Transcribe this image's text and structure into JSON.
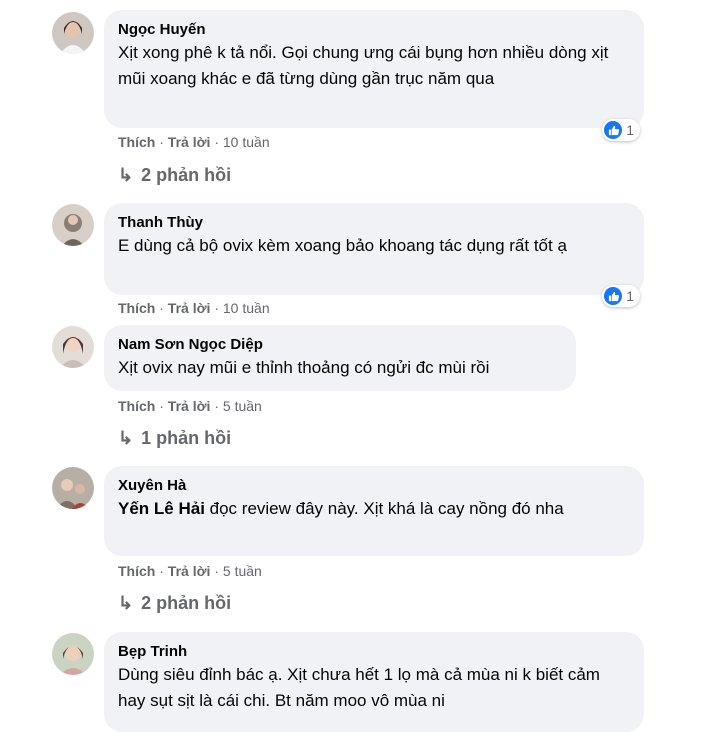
{
  "comments": [
    {
      "author": "Ngọc Huyến",
      "text": "Xịt xong phê k tả nổi. Gọi chung ưng cái bụng hơn nhiều dòng xịt mũi xoang khác e đã từng dùng gần trục năm qua",
      "like_label": "Thích",
      "reply_label": "Trả lời",
      "time": "10 tuần",
      "reactions": "1",
      "replies": "2 phản hồi"
    },
    {
      "author": "Thanh Thùy",
      "text": "E dùng cả bộ ovix kèm xoang bảo khoang tác dụng rất tốt ạ",
      "like_label": "Thích",
      "reply_label": "Trả lời",
      "time": "10 tuần",
      "reactions": "1"
    },
    {
      "author": "Nam Sơn Ngọc Diệp",
      "text": "Xịt ovix nay mũi e thỉnh thoảng có ngửi đc mùi rồi",
      "like_label": "Thích",
      "reply_label": "Trả lời",
      "time": "5 tuần",
      "replies": "1 phản hồi"
    },
    {
      "author": "Xuyên Hà",
      "mention": "Yến Lê Hải",
      "text": " đọc review đây này. Xịt khá là cay nồng đó nha",
      "like_label": "Thích",
      "reply_label": "Trả lời",
      "time": "5 tuần",
      "replies": "2 phản hồi"
    },
    {
      "author": "Bẹp Trinh",
      "text": "Dùng siêu đỉnh bác ạ. Xịt chưa hết 1 lọ mà cả mùa ni k biết cảm hay sụt sịt là cái chi. Bt năm moo vô mùa ni"
    }
  ],
  "separator": " · ",
  "reply_arrow": "↳"
}
